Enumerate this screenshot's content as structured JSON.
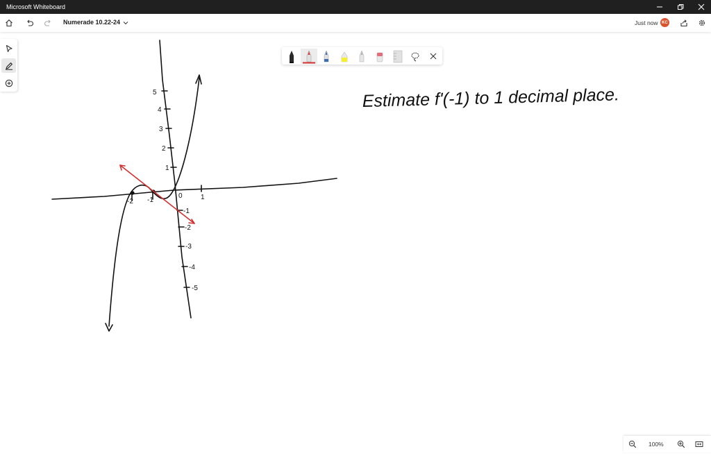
{
  "window": {
    "title": "Microsoft Whiteboard",
    "controls": [
      "minimize",
      "restore",
      "close"
    ]
  },
  "toolbar": {
    "board_name": "Numerade 10.22-24",
    "save_status": "Just now",
    "user_initials": "KC"
  },
  "pen_tray": {
    "pens": [
      {
        "name": "black-pen",
        "color": "#111111"
      },
      {
        "name": "red-pen",
        "color": "#d32f2f",
        "active": true
      },
      {
        "name": "blue-pen",
        "color": "#3b6db3"
      },
      {
        "name": "yellow-highlighter",
        "color": "#f5f032"
      },
      {
        "name": "gray-pen",
        "color": "#b0b0b0"
      },
      {
        "name": "eraser",
        "color": "#e46b7a"
      },
      {
        "name": "ruler",
        "color": "#c8c8c8"
      }
    ]
  },
  "zoom": {
    "level": "100%"
  },
  "whiteboard": {
    "prompt": "Estimate f'(-1) to 1 decimal place.",
    "x_tick_labels": [
      "-2",
      "-1",
      "0",
      "1"
    ],
    "y_tick_labels_positive": [
      "5",
      "4",
      "3",
      "2",
      "1"
    ],
    "y_tick_labels_negative": [
      "-1",
      "-2",
      "-3",
      "-4",
      "-5"
    ],
    "ink_colors": {
      "graph": "#111111",
      "tangent": "#d32f2f"
    }
  }
}
